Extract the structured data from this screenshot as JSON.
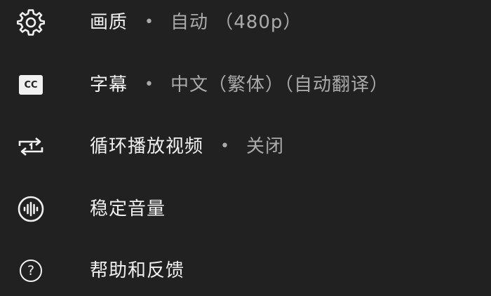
{
  "menu": {
    "items": [
      {
        "icon": "gear-icon",
        "label": "画质",
        "separator": "•",
        "value": "自动 （480p）"
      },
      {
        "icon": "closed-captions-icon",
        "label": "字幕",
        "separator": "•",
        "value": "中文（繁体）（自动翻译）",
        "icon_text": "CC"
      },
      {
        "icon": "loop-one-icon",
        "label": "循环播放视频",
        "separator": "•",
        "value": "关闭"
      },
      {
        "icon": "stable-volume-icon",
        "label": "稳定音量"
      },
      {
        "icon": "help-icon",
        "label": "帮助和反馈",
        "icon_text": "?"
      }
    ]
  }
}
